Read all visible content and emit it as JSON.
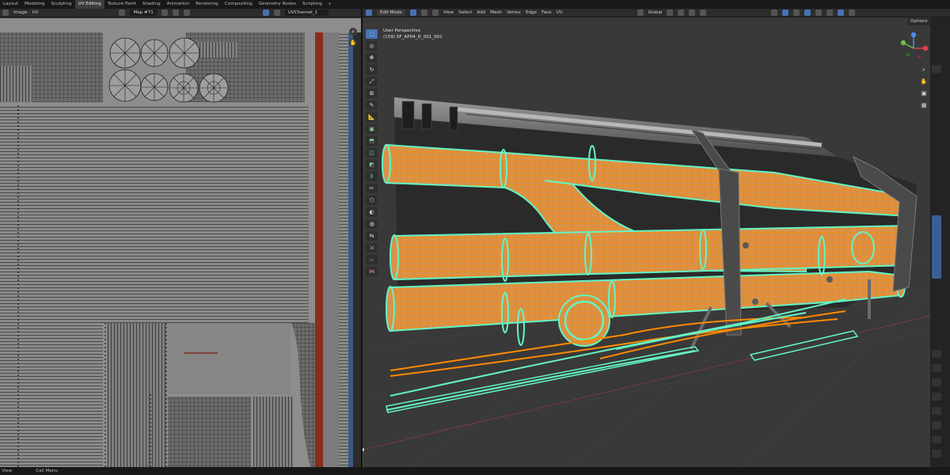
{
  "workspace_tabs": [
    {
      "label": "Layout",
      "active": false
    },
    {
      "label": "Modeling",
      "active": false
    },
    {
      "label": "Sculpting",
      "active": false
    },
    {
      "label": "UV Editing",
      "active": true
    },
    {
      "label": "Texture Paint",
      "active": false
    },
    {
      "label": "Shading",
      "active": false
    },
    {
      "label": "Animation",
      "active": false
    },
    {
      "label": "Rendering",
      "active": false
    },
    {
      "label": "Compositing",
      "active": false
    },
    {
      "label": "Geometry Nodes",
      "active": false
    },
    {
      "label": "Scripting",
      "active": false
    }
  ],
  "add_workspace": "+",
  "uv_header": {
    "menus": [
      "Image",
      "UV"
    ],
    "image_name": "Map #71",
    "uv_map": "UVChannel_1"
  },
  "viewport_header": {
    "mode": "Edit Mode",
    "menus": [
      "View",
      "Select",
      "Add",
      "Mesh",
      "Vertex",
      "Edge",
      "Face",
      "UV"
    ],
    "orientation": "Global",
    "options": "Options"
  },
  "viewport_info": {
    "line1": "User Perspective",
    "line2": "(159) SF_AP04_D_001_001"
  },
  "toolbar_icons": [
    "select-box-icon",
    "cursor-icon",
    "move-icon",
    "rotate-icon",
    "scale-icon",
    "transform-icon",
    "annotate-icon",
    "measure-icon",
    "add-cube-icon",
    "extrude-icon",
    "inset-icon",
    "bevel-icon",
    "loop-cut-icon",
    "knife-icon",
    "poly-build-icon",
    "spin-icon",
    "smooth-icon",
    "edge-slide-icon",
    "shrink-icon",
    "shear-icon",
    "rip-icon"
  ],
  "status_bar": {
    "left": "View",
    "middle": "Call Menu"
  },
  "colors": {
    "pipe": "#d9924a",
    "wire": "#ff8a00",
    "selected_edge": "#62f5c6",
    "viewport_bg": "#393939",
    "uv_bg": "#8d8d8d",
    "accent": "#4772b3"
  }
}
